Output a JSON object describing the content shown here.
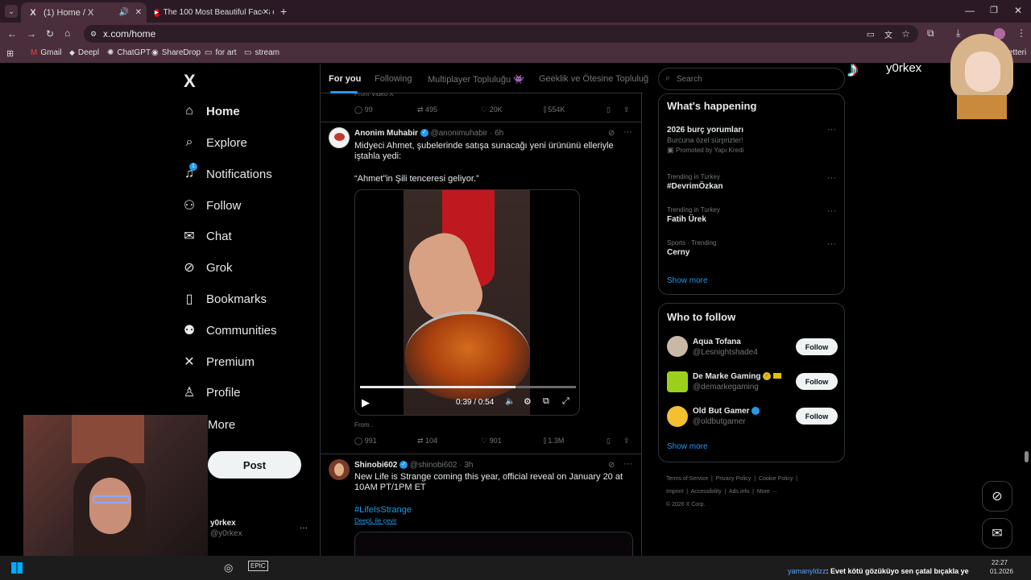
{
  "browser": {
    "tabs": [
      {
        "title": "(1) Home / X"
      },
      {
        "title": "The 100 Most Beautiful Faces o"
      }
    ],
    "url": "x.com/home",
    "bookmarks": [
      "Gmail",
      "Deepl",
      "ChatGPT",
      "ShareDrop",
      "for art",
      "stream"
    ],
    "bookmarks_overflow": "etteri"
  },
  "nav": {
    "logo": "X",
    "items": [
      {
        "label": "Home",
        "icon": "home-icon"
      },
      {
        "label": "Explore",
        "icon": "search-icon"
      },
      {
        "label": "Notifications",
        "icon": "bell-icon",
        "badge": "1"
      },
      {
        "label": "Follow",
        "icon": "add-person-icon"
      },
      {
        "label": "Chat",
        "icon": "mail-icon"
      },
      {
        "label": "Grok",
        "icon": "grok-icon"
      },
      {
        "label": "Bookmarks",
        "icon": "bookmark-icon"
      },
      {
        "label": "Communities",
        "icon": "people-icon"
      },
      {
        "label": "Premium",
        "icon": "x-icon"
      },
      {
        "label": "Profile",
        "icon": "person-icon"
      },
      {
        "label": "More",
        "icon": "more-icon"
      }
    ],
    "post_label": "Post",
    "account": {
      "name": "y0rkex",
      "handle": "@y0rkex"
    }
  },
  "feed": {
    "tabs": [
      "For you",
      "Following",
      "Multiplayer Topluluğu 👾",
      "Geeklik ve Ötesine Topluluğ"
    ],
    "prev_tweet": {
      "from": "From Video X",
      "replies": "99",
      "reposts": "495",
      "likes": "20K",
      "views": "554K"
    },
    "tweet1": {
      "name": "Anonim Muhabir",
      "handle": "@anonimuhabir",
      "time": "6h",
      "text1": "Midyeci Ahmet, şubelerinde satışa sunacağı yeni ürününü elleriyle iştahla yedi:",
      "text2": "“Ahmet”in Şili tenceresi geliyor.”",
      "video_time": "0:39 / 0:54",
      "video_progress": 0.72,
      "from": "From .",
      "replies": "991",
      "reposts": "104",
      "likes": "901",
      "views": "1.3M"
    },
    "tweet2": {
      "name": "Shinobi602",
      "handle": "@shinobi602",
      "time": "3h",
      "text": "New Life is Strange coming this year, official reveal on January 20 at 10AM PT/1PM ET",
      "hashtag": "#LifeIsStrange",
      "translate": "DeepL ile çevir"
    }
  },
  "sidebar": {
    "search_placeholder": "Search",
    "happening_title": "What's happening",
    "trends": [
      {
        "title": "2026 burç yorumları",
        "sub": "Burcuna özel sürprizler!",
        "meta": "Promoted by Yapı Kredi"
      },
      {
        "context": "Trending in Turkey",
        "title": "#DevrimÖzkan"
      },
      {
        "context": "Trending in Turkey",
        "title": "Fatih Ürek"
      },
      {
        "context": "Sports · Trending",
        "title": "Cerny"
      }
    ],
    "show_more": "Show more",
    "who_title": "Who to follow",
    "who": [
      {
        "name": "Aqua Tofana",
        "handle": "@Lesnightshade4",
        "color": "#c9b8a5"
      },
      {
        "name": "De Marke Gaming",
        "handle": "@demarkegaming",
        "color": "#9ad01d"
      },
      {
        "name": "Old But Gamer",
        "handle": "@oldbutgamer",
        "color": "#f2c030"
      }
    ],
    "follow_label": "Follow",
    "footer": [
      "Terms of Service",
      "Privacy Policy",
      "Cookie Policy",
      "Imprint",
      "Accessibility",
      "Ads info",
      "More ···",
      "© 2026 X Corp."
    ]
  },
  "overlay": {
    "tiktok_name": "y0rkex",
    "chat_user": "yamanyldzz",
    "chat_text": ": Evet kötü gözüküyo sen çatal bıçakla ye"
  },
  "taskbar": {
    "time": "22:27",
    "date": "01.2026"
  }
}
